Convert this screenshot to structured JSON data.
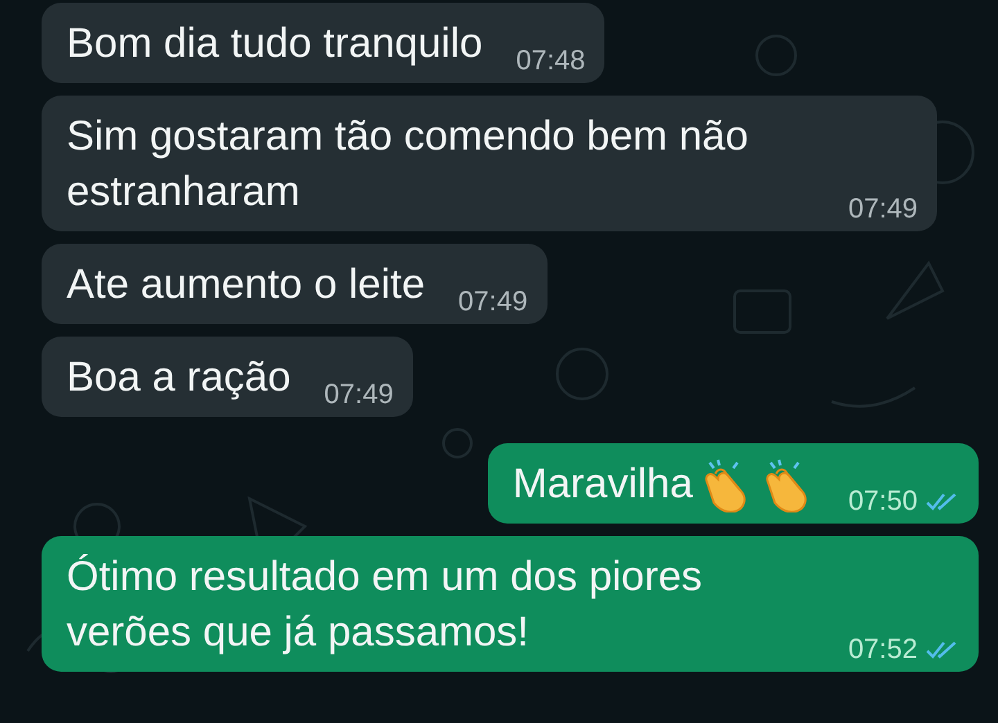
{
  "messages": [
    {
      "outgoing": false,
      "text": "Bom dia tudo tranquilo",
      "time": "07:48"
    },
    {
      "outgoing": false,
      "text": "Sim gostaram tão comendo bem não estranharam",
      "time": "07:49"
    },
    {
      "outgoing": false,
      "text": "Ate aumento o leite",
      "time": "07:49"
    },
    {
      "outgoing": false,
      "text": "Boa a ração",
      "time": "07:49"
    },
    {
      "outgoing": true,
      "kind": "clap_pair",
      "text": "Maravilha",
      "time": "07:50",
      "read": true
    },
    {
      "outgoing": true,
      "kind": "plain",
      "text": "Ótimo resultado em um dos piores verões que já passamos!",
      "time": "07:52",
      "read": true
    }
  ]
}
